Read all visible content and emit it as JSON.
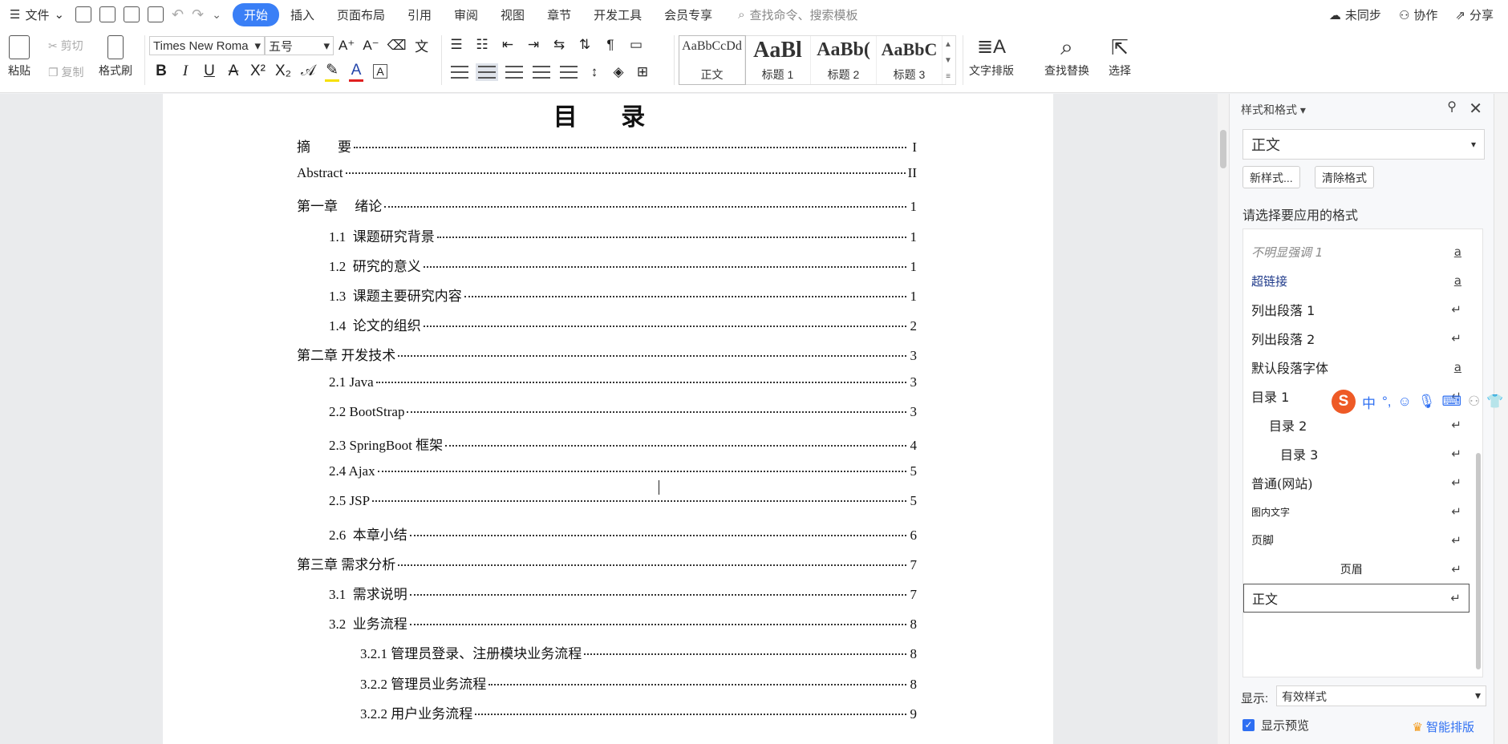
{
  "menubar": {
    "file_label": "文件",
    "tabs": [
      "开始",
      "插入",
      "页面布局",
      "引用",
      "审阅",
      "视图",
      "章节",
      "开发工具",
      "会员专享"
    ],
    "active_tab": "开始",
    "search_placeholder": "查找命令、搜索模板",
    "unsync": "未同步",
    "collab": "协作",
    "share": "分享"
  },
  "ribbon": {
    "paste": "粘贴",
    "cut": "剪切",
    "copy": "复制",
    "format_painter": "格式刷",
    "font_name": "Times New Roma",
    "font_size": "五号",
    "styles": [
      {
        "preview": "AaBbCcDd",
        "name": "正文"
      },
      {
        "preview": "AaBl",
        "name": "标题 1"
      },
      {
        "preview": "AaBb(",
        "name": "标题 2"
      },
      {
        "preview": "AaBbC",
        "name": "标题 3"
      }
    ],
    "text_layout": "文字排版",
    "find_replace": "查找替换",
    "select": "选择"
  },
  "document": {
    "toc_title": "目 录",
    "toc": [
      {
        "text": "摘　　要",
        "page": "I",
        "level": 0
      },
      {
        "text": "Abstract",
        "page": "II",
        "level": 0
      },
      {
        "text": "第一章　 绪论",
        "page": "1",
        "level": 0
      },
      {
        "text": "1.1  课题研究背景",
        "page": "1",
        "level": 1
      },
      {
        "text": "1.2  研究的意义",
        "page": "1",
        "level": 1
      },
      {
        "text": "1.3  课题主要研究内容",
        "page": "1",
        "level": 1
      },
      {
        "text": "1.4  论文的组织",
        "page": "2",
        "level": 1
      },
      {
        "text": "第二章 开发技术",
        "page": "3",
        "level": 0
      },
      {
        "text": "2.1 Java",
        "page": "3",
        "level": 1
      },
      {
        "text": "2.2 BootStrap",
        "page": "3",
        "level": 1
      },
      {
        "text": "2.3 SpringBoot 框架",
        "page": "4",
        "level": 1
      },
      {
        "text": "2.4 Ajax",
        "page": "5",
        "level": 1
      },
      {
        "text": "2.5 JSP",
        "page": "5",
        "level": 1
      },
      {
        "text": "2.6  本章小结",
        "page": "6",
        "level": 1
      },
      {
        "text": "第三章 需求分析",
        "page": "7",
        "level": 0
      },
      {
        "text": "3.1  需求说明",
        "page": "7",
        "level": 1
      },
      {
        "text": "3.2  业务流程",
        "page": "8",
        "level": 1
      },
      {
        "text": "3.2.1 管理员登录、注册模块业务流程",
        "page": "8",
        "level": 2
      },
      {
        "text": "3.2.2 管理员业务流程",
        "page": "8",
        "level": 2
      },
      {
        "text": "3.2.2 用户业务流程",
        "page": "9",
        "level": 2
      }
    ]
  },
  "pane": {
    "title": "样式和格式",
    "current_style": "正文",
    "new_style": "新样式...",
    "clear_format": "清除格式",
    "subtitle": "请选择要应用的格式",
    "items": [
      {
        "label": "不明显强调 1",
        "mark": "a"
      },
      {
        "label": "超链接",
        "mark": "a"
      },
      {
        "label": "列出段落 1",
        "mark": "↵"
      },
      {
        "label": "列出段落 2",
        "mark": "↵"
      },
      {
        "label": "默认段落字体",
        "mark": "a"
      },
      {
        "label": "目录 1",
        "mark": "↵"
      },
      {
        "label": "目录 2",
        "mark": "↵"
      },
      {
        "label": "目录 3",
        "mark": "↵"
      },
      {
        "label": "普通(网站)",
        "mark": "↵"
      },
      {
        "label": "图内文字",
        "mark": "↵"
      },
      {
        "label": "页脚",
        "mark": "↵"
      },
      {
        "label": "页眉",
        "mark": "↵"
      },
      {
        "label": "正文",
        "mark": "↵"
      }
    ],
    "show_label": "显示:",
    "show_value": "有效样式",
    "preview_label": "显示预览",
    "smart_layout": "智能排版"
  },
  "ime": {
    "lang": "中"
  }
}
